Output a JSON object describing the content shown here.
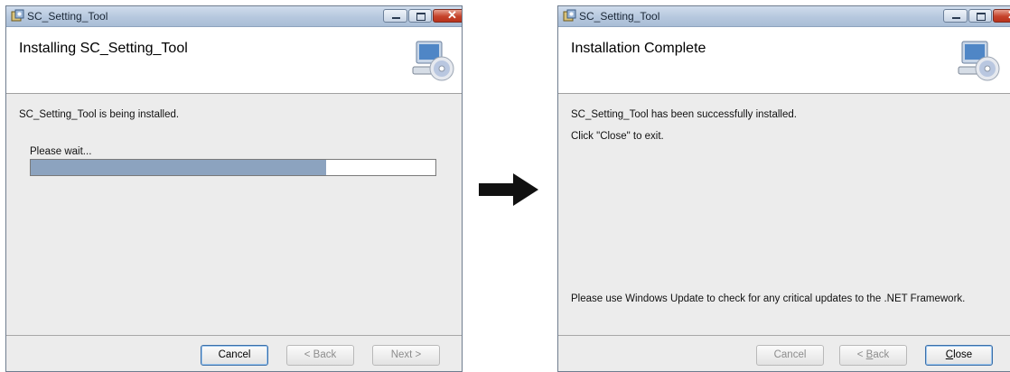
{
  "left_window": {
    "title": "SC_Setting_Tool",
    "banner_title": "Installing SC_Setting_Tool",
    "status": "SC_Setting_Tool is being installed.",
    "wait_label": "Please wait...",
    "progress": 0.73,
    "buttons": {
      "cancel": "Cancel",
      "back": "< Back",
      "next": "Next >"
    }
  },
  "right_window": {
    "title": "SC_Setting_Tool",
    "banner_title": "Installation Complete",
    "message": "SC_Setting_Tool has been successfully installed.",
    "instruction": "Click \"Close\" to exit.",
    "update_note": "Please use Windows Update to check for any critical updates to the .NET Framework.",
    "buttons": {
      "cancel": "Cancel",
      "back_accel": "B",
      "back_rest": "ack",
      "close_accel": "C",
      "close_rest": "lose"
    }
  },
  "icons": {
    "app": "installer-icon",
    "banner": "computer-disc-icon",
    "transition": "right-arrow-icon"
  },
  "colors": {
    "progress_fill": "#8ca3bf",
    "title_bar": "#b6c8de",
    "close_button": "#c5432b"
  }
}
